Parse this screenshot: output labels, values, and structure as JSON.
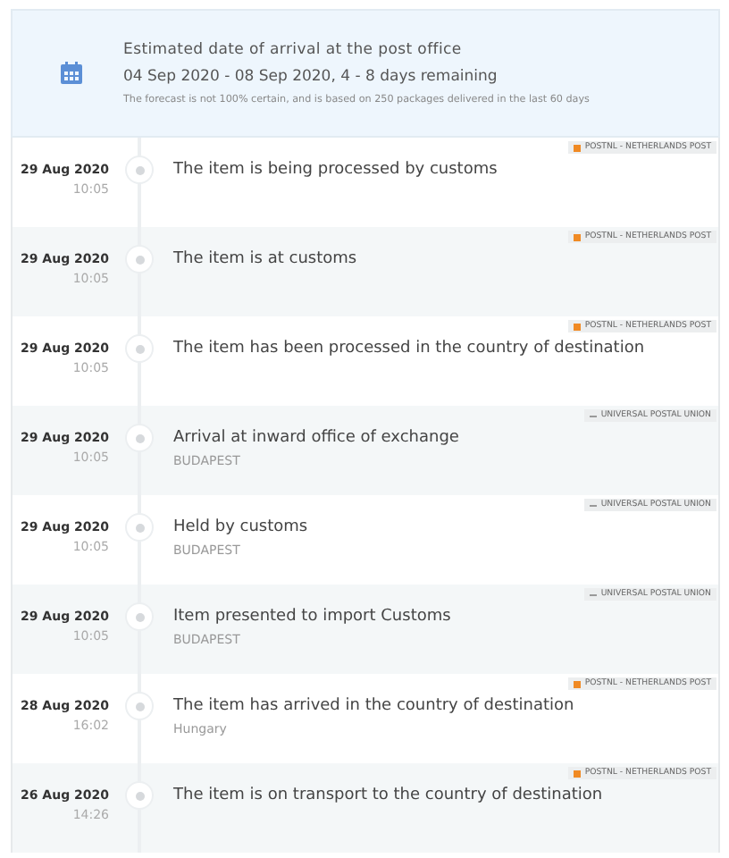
{
  "estimate": {
    "title": "Estimated date of arrival at the post office",
    "range": "04 Sep 2020 - 08 Sep 2020, 4 - 8 days remaining",
    "note": "The forecast is not 100% certain, and is based on 250 packages delivered in the last 60 days"
  },
  "events": [
    {
      "date": "29 Aug 2020",
      "time": "10:05",
      "status": "The item is being processed by customs",
      "carrier": {
        "kind": "postnl",
        "label": "POSTNL - NETHERLANDS POST"
      }
    },
    {
      "date": "29 Aug 2020",
      "time": "10:05",
      "status": "The item is at customs",
      "carrier": {
        "kind": "postnl",
        "label": "POSTNL - NETHERLANDS POST"
      }
    },
    {
      "date": "29 Aug 2020",
      "time": "10:05",
      "status": "The item has been processed in the country of destination",
      "carrier": {
        "kind": "postnl",
        "label": "POSTNL - NETHERLANDS POST"
      }
    },
    {
      "date": "29 Aug 2020",
      "time": "10:05",
      "status": "Arrival at inward office of exchange",
      "location": "BUDAPEST",
      "carrier": {
        "kind": "upu",
        "label": "UNIVERSAL POSTAL UNION"
      }
    },
    {
      "date": "29 Aug 2020",
      "time": "10:05",
      "status": "Held by customs",
      "location": "BUDAPEST",
      "carrier": {
        "kind": "upu",
        "label": "UNIVERSAL POSTAL UNION"
      }
    },
    {
      "date": "29 Aug 2020",
      "time": "10:05",
      "status": "Item presented to import Customs",
      "location": "BUDAPEST",
      "carrier": {
        "kind": "upu",
        "label": "UNIVERSAL POSTAL UNION"
      }
    },
    {
      "date": "28 Aug 2020",
      "time": "16:02",
      "status": "The item has arrived in the country of destination",
      "location": "Hungary",
      "carrier": {
        "kind": "postnl",
        "label": "POSTNL - NETHERLANDS POST"
      }
    },
    {
      "date": "26 Aug 2020",
      "time": "14:26",
      "status": "The item is on transport to the country of destination",
      "carrier": {
        "kind": "postnl",
        "label": "POSTNL - NETHERLANDS POST"
      }
    }
  ]
}
